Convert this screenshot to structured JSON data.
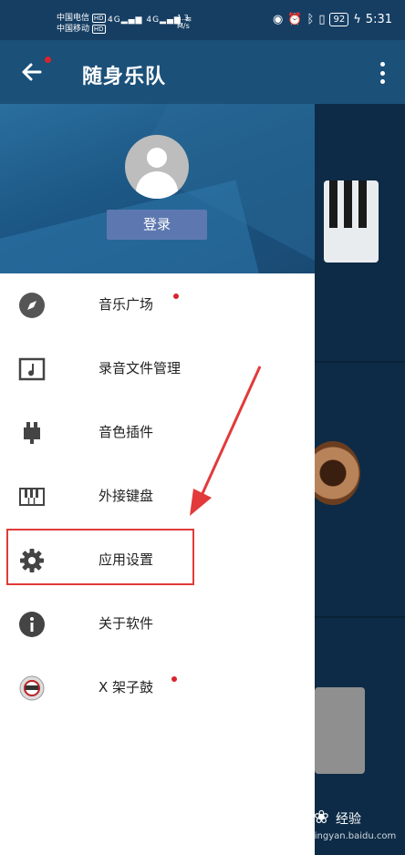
{
  "status_bar": {
    "carrier_1": "中国电信",
    "carrier_2": "中国移动",
    "hd": "HD",
    "signal_1": "4G",
    "signal_2": "4G",
    "speed_value": "1.3",
    "speed_unit": "M/s",
    "battery": "92",
    "time": "5:31"
  },
  "app_bar": {
    "title": "随身乐队"
  },
  "drawer": {
    "login_label": "登录",
    "menu_items": [
      {
        "label": "音乐广场",
        "icon": "compass-icon",
        "badge": true
      },
      {
        "label": "录音文件管理",
        "icon": "music-file-icon",
        "badge": false
      },
      {
        "label": "音色插件",
        "icon": "plugin-icon",
        "badge": false
      },
      {
        "label": "外接键盘",
        "icon": "keyboard-icon",
        "badge": false
      },
      {
        "label": "应用设置",
        "icon": "gear-icon",
        "badge": false
      },
      {
        "label": "关于软件",
        "icon": "info-icon",
        "badge": false
      },
      {
        "label": "X 架子鼓",
        "icon": "drum-icon",
        "badge": true
      }
    ]
  },
  "watermark": {
    "text": "经验",
    "url": "jingyan.baidu.com"
  },
  "colors": {
    "app_bar": "#1b5079",
    "status_bar": "#163e63",
    "login_button": "#5d78b0",
    "annotation": "#e23a3a",
    "badge": "#d9232d"
  }
}
